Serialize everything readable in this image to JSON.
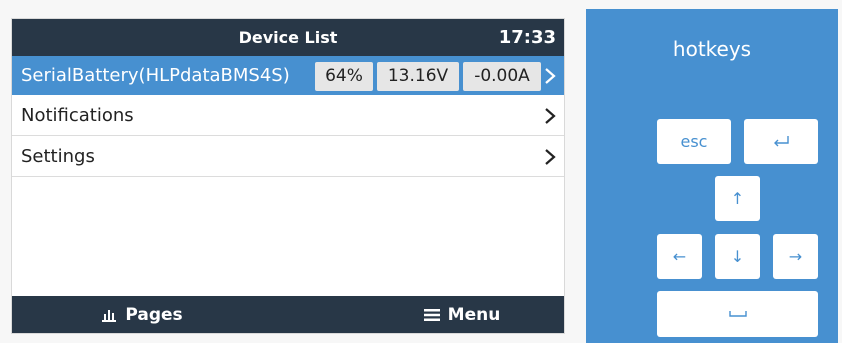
{
  "device_screen": {
    "title": "Device List",
    "time": "17:33",
    "rows": [
      {
        "label": "SerialBattery(HLPdataBMS4S)",
        "soc": "64%",
        "voltage": "13.16V",
        "current": "-0.00A",
        "selected": true
      },
      {
        "label": "Notifications"
      },
      {
        "label": "Settings"
      }
    ],
    "bottom_bar": {
      "pages_label": "Pages",
      "menu_label": "Menu"
    }
  },
  "hotkeys_panel": {
    "title": "hotkeys",
    "keys": {
      "esc": "esc",
      "enter": "⏎",
      "up": "↑",
      "left": "←",
      "down": "↓",
      "right": "→",
      "space": "␣"
    }
  },
  "colors": {
    "title_bar": "#283747",
    "accent_blue": "#4790d0",
    "badge_bg": "#e6e6e6"
  }
}
